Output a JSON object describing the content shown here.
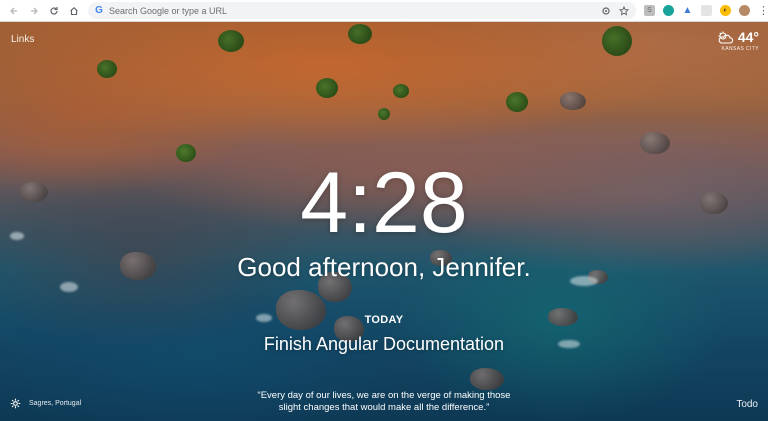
{
  "browser": {
    "omnibox_placeholder": "Search Google or type a URL",
    "omnibox_logo": "G",
    "icons": {
      "back": "arrow-left-icon",
      "forward": "arrow-right-icon",
      "reload": "reload-icon",
      "home": "home-icon",
      "extension": "extension-puzzle-icon",
      "bookmark": "star-icon",
      "menu": "kebab-menu-icon"
    }
  },
  "top_left": {
    "links_label": "Links"
  },
  "weather": {
    "temperature": "44°",
    "location": "KANSAS CITY",
    "icon": "partly-cloudy-icon"
  },
  "main": {
    "time": "4:28",
    "greeting": "Good afternoon, Jennifer.",
    "today_label": "TODAY",
    "focus_task": "Finish Angular Documentation"
  },
  "footer": {
    "photo_location": "Sagres, Portugal",
    "quote_line1": "“Every day of our lives, we are on the verge of making those",
    "quote_line2": "slight changes that would make all the difference.”",
    "todo_label": "Todo"
  },
  "colors": {
    "text": "#ffffff",
    "chrome_bg": "#ffffff",
    "omnibox_bg": "#f1f3f4"
  }
}
